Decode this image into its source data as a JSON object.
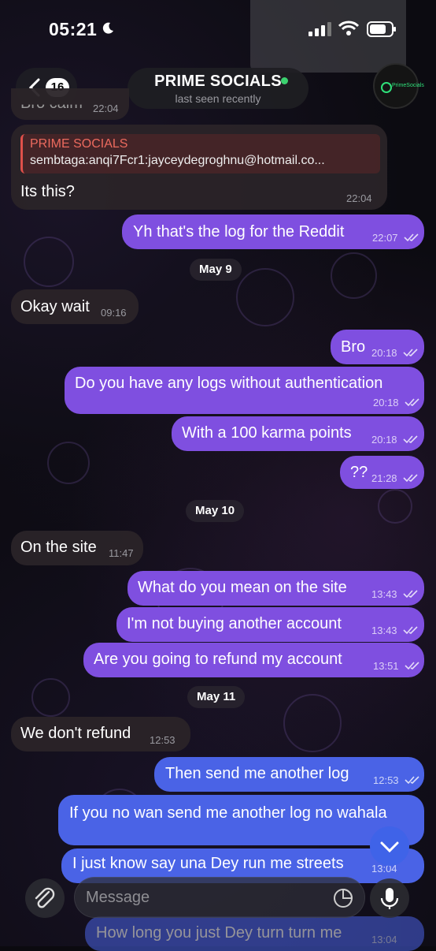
{
  "status_bar": {
    "time": "05:21"
  },
  "header": {
    "unread_count": "16",
    "chat_name": "PRIME SOCIALS",
    "chat_status": "last seen recently",
    "avatar_text": "PrimeSocials"
  },
  "messages": [
    {
      "text": "Bro calm",
      "time": "22:04"
    },
    {
      "reply_to": "PRIME SOCIALS",
      "reply_text": "sembtaga:anqi7Fcr1:jayceydegroghnu@hotmail.co...",
      "text": "Its this?",
      "time": "22:04"
    },
    {
      "text": "Yh that's the log for the Reddit",
      "time": "22:07"
    },
    {
      "date": "May 9"
    },
    {
      "text": "Okay wait",
      "time": "09:16"
    },
    {
      "text": "Bro",
      "time": "20:18"
    },
    {
      "text": "Do you have any logs without authentication",
      "time": "20:18"
    },
    {
      "text": "With a 100 karma points",
      "time": "20:18"
    },
    {
      "text": "??",
      "time": "21:28"
    },
    {
      "date": "May 10"
    },
    {
      "text": "On the site",
      "time": "11:47"
    },
    {
      "text": "What do you mean on the site",
      "time": "13:43"
    },
    {
      "text": "I'm not buying another account",
      "time": "13:43"
    },
    {
      "text": "Are you going to refund my account",
      "time": "13:51"
    },
    {
      "date": "May 11"
    },
    {
      "text": "We don't refund",
      "time": "12:53"
    },
    {
      "text": "Then send me another log",
      "time": "12:53"
    },
    {
      "text": "If you no wan send me another log no wahala",
      "time": ""
    },
    {
      "text": "I just know say una Dey run me streets",
      "time": "13:04"
    },
    {
      "text": "How long you just Dey turn turn me",
      "time": "13:04"
    }
  ],
  "input": {
    "placeholder": "Message"
  },
  "colors": {
    "outgoing": "#7f4fe0",
    "outgoing_alt": "#4a63e6",
    "incoming": "#2a2428",
    "online": "#3bd16f"
  }
}
